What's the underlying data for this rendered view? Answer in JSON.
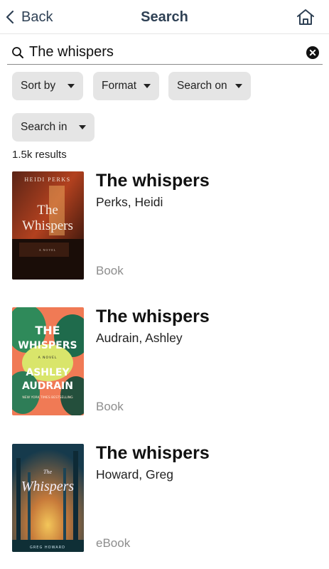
{
  "header": {
    "back_label": "Back",
    "title": "Search"
  },
  "search": {
    "value": "The whispers"
  },
  "filters": {
    "sort_by": "Sort by",
    "format": "Format",
    "search_on": "Search on",
    "search_in": "Search in"
  },
  "results_count": "1.5k results",
  "results": [
    {
      "title": "The whispers",
      "author": "Perks, Heidi",
      "format": "Book",
      "cover_text": {
        "author": "HEIDI PERKS",
        "title_line1": "The",
        "title_line2": "Whispers",
        "tag": "A NOVEL"
      }
    },
    {
      "title": "The whispers",
      "author": "Audrain, Ashley",
      "format": "Book",
      "cover_text": {
        "title_line1": "THE",
        "title_line2": "WHISPERS",
        "tag": "A NOVEL",
        "author_line1": "ASHLEY",
        "author_line2": "AUDRAIN",
        "banner": "NEW YORK TIMES BESTSELLING"
      }
    },
    {
      "title": "The whispers",
      "author": "Howard, Greg",
      "format": "eBook",
      "cover_text": {
        "title_line1": "The",
        "title_line2": "Whispers",
        "author": "GREG HOWARD"
      }
    }
  ],
  "colors": {
    "header_text": "#2f4155",
    "chip_bg": "#e5e5e5",
    "format_text": "#8d8d8d"
  }
}
